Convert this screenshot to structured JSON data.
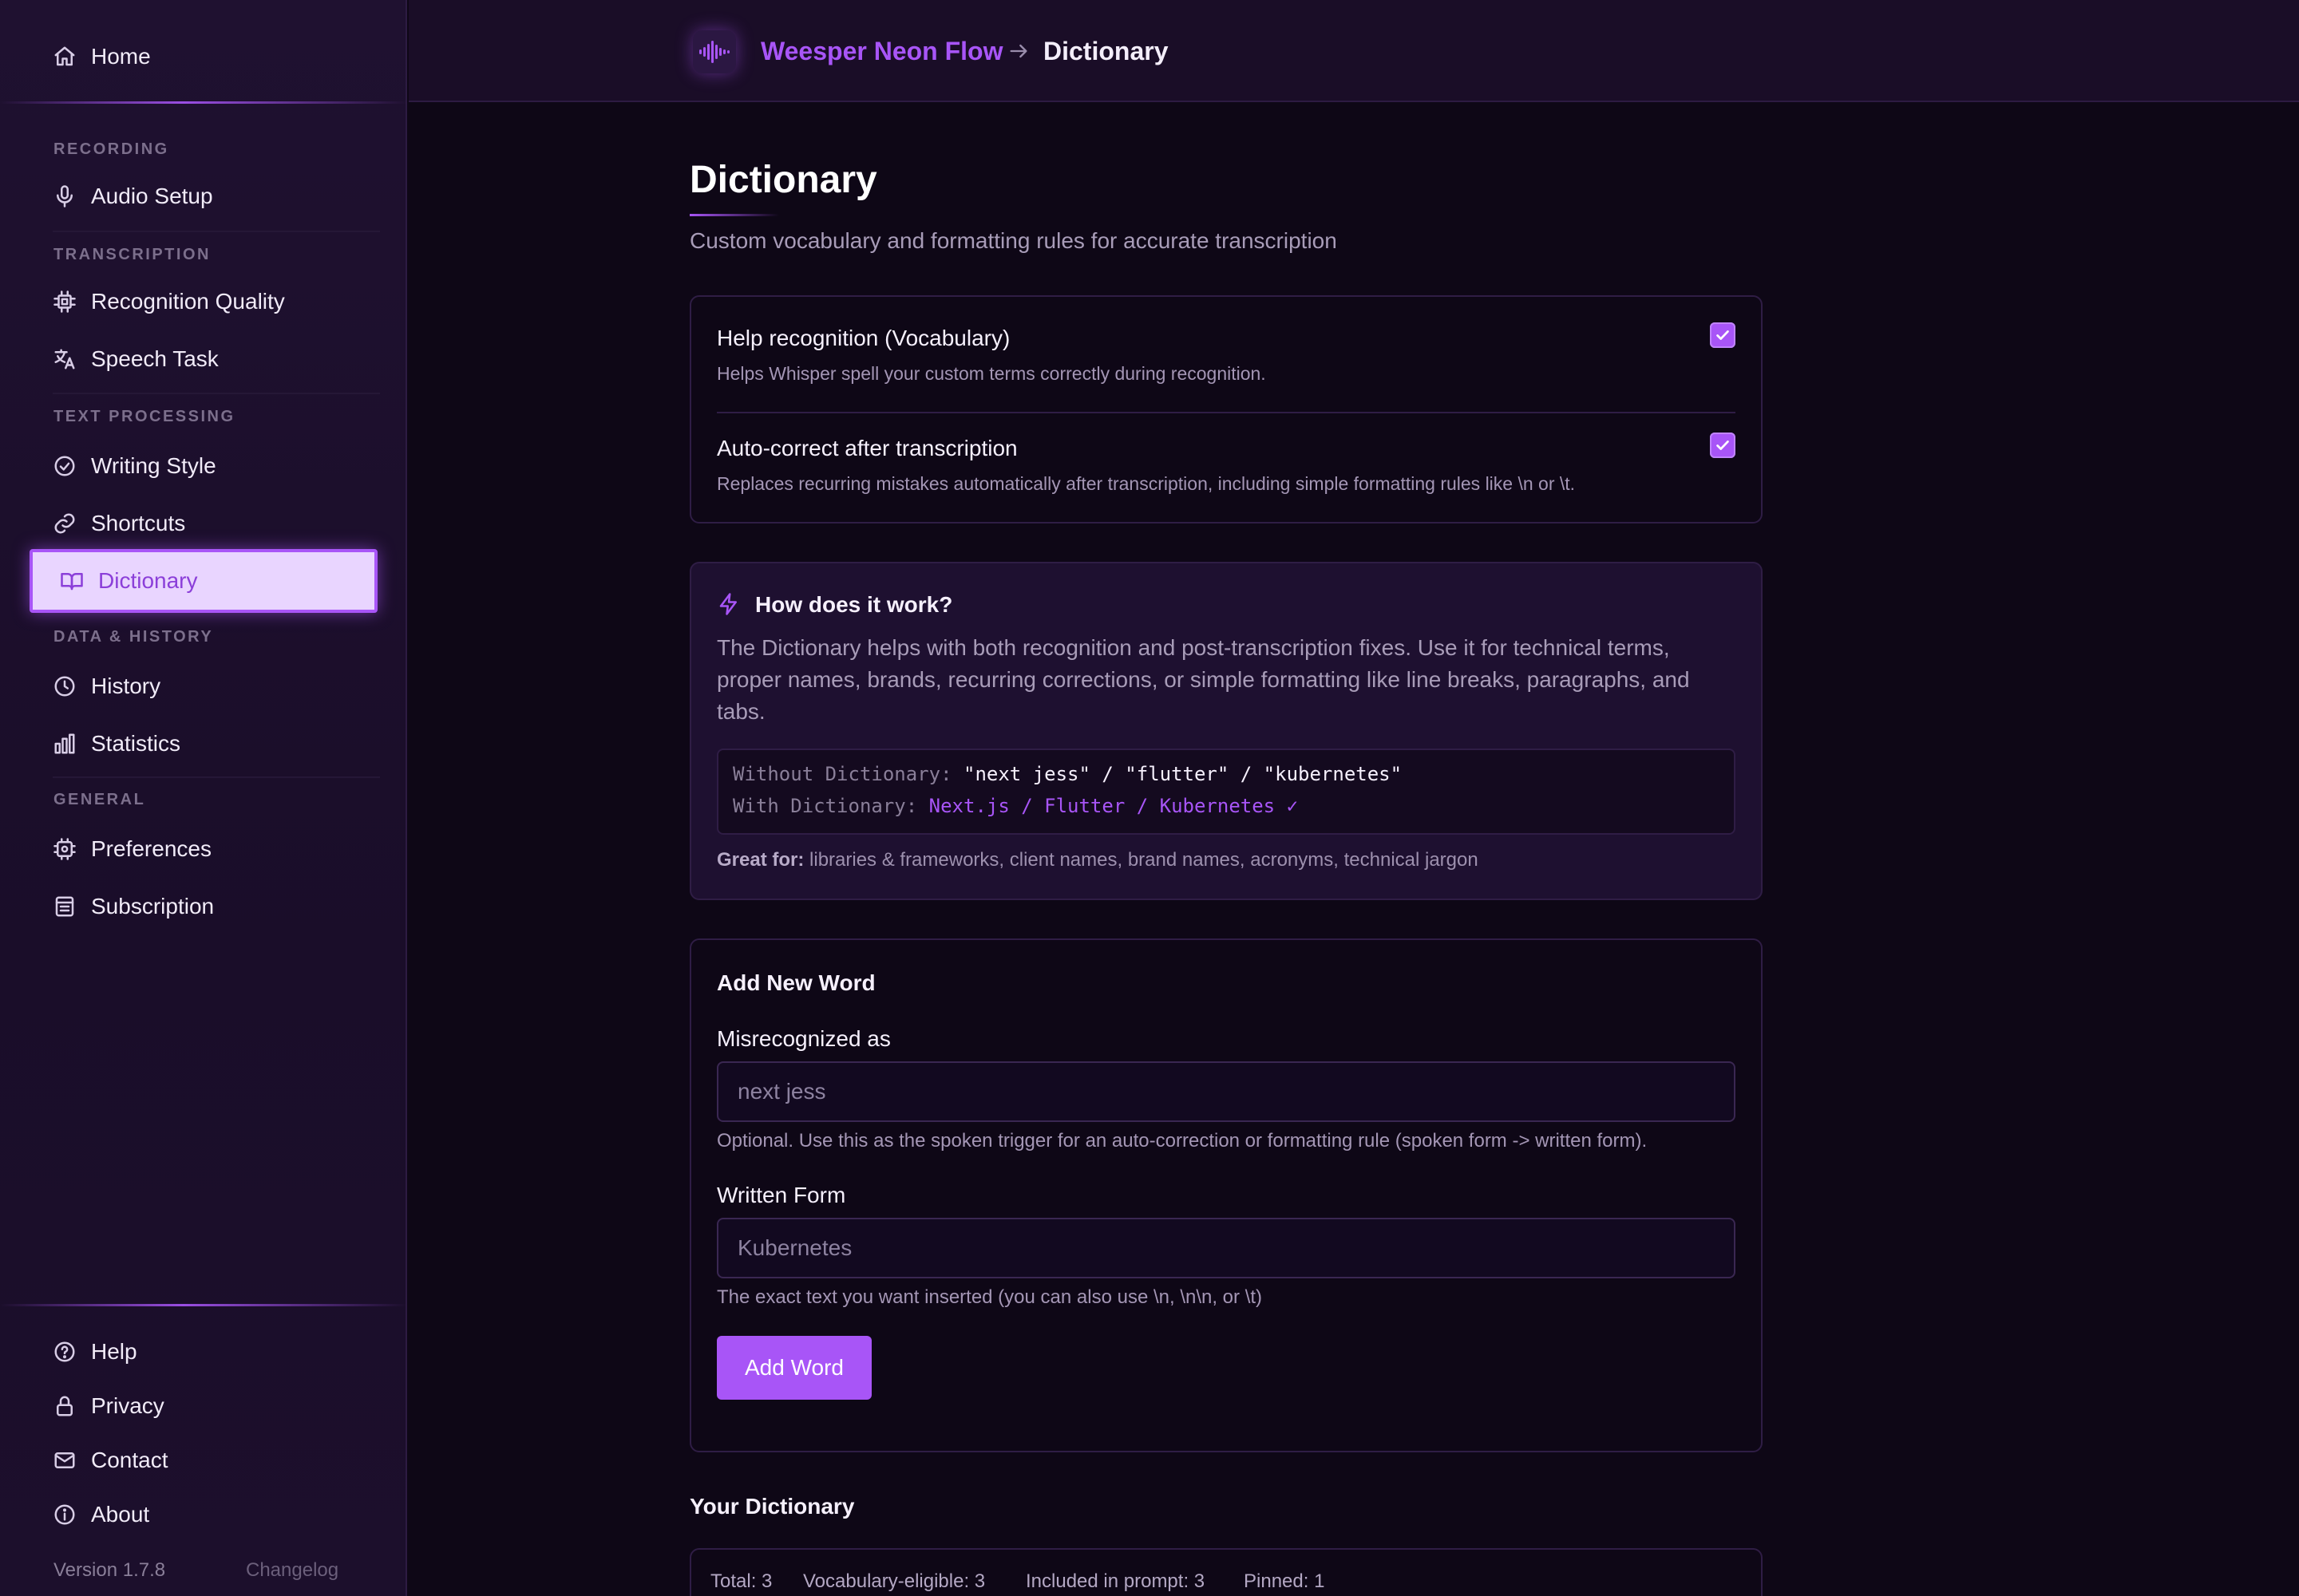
{
  "sidebar": {
    "home": "Home",
    "sections": {
      "recording": "RECORDING",
      "transcription": "TRANSCRIPTION",
      "text_processing": "TEXT PROCESSING",
      "data_history": "DATA & HISTORY",
      "general": "GENERAL"
    },
    "items": {
      "audio_setup": "Audio Setup",
      "recognition_quality": "Recognition Quality",
      "speech_task": "Speech Task",
      "writing_style": "Writing Style",
      "shortcuts": "Shortcuts",
      "dictionary": "Dictionary",
      "history": "History",
      "statistics": "Statistics",
      "preferences": "Preferences",
      "subscription": "Subscription"
    },
    "active_item": "dictionary",
    "footer": {
      "help": "Help",
      "privacy": "Privacy",
      "contact": "Contact",
      "about": "About",
      "version": "Version 1.7.8",
      "changelog": "Changelog"
    }
  },
  "breadcrumb": {
    "app_name": "Weesper Neon Flow",
    "current": "Dictionary"
  },
  "page": {
    "title": "Dictionary",
    "subtitle": "Custom vocabulary and formatting rules for accurate transcription"
  },
  "toggles": [
    {
      "title": "Help recognition (Vocabulary)",
      "description": "Helps Whisper spell your custom terms correctly during recognition.",
      "checked": true
    },
    {
      "title": "Auto-correct after transcription",
      "description": "Replaces recurring mistakes automatically after transcription, including simple formatting rules like \\n or \\t.",
      "checked": true
    }
  ],
  "info": {
    "heading": "How does it work?",
    "body": "The Dictionary helps with both recognition and post-transcription fixes. Use it for technical terms, proper names, brands, recurring corrections, or simple formatting like line breaks, paragraphs, and tabs.",
    "without_label": "Without Dictionary:",
    "without_value": "\"next jess\" / \"flutter\" / \"kubernetes\"",
    "with_label": "With Dictionary:",
    "with_value": "Next.js / Flutter / Kubernetes ✓",
    "great_for_label": "Great for:",
    "great_for_value": "libraries & frameworks, client names, brand names, acronyms, technical jargon"
  },
  "add_word": {
    "title": "Add New Word",
    "misrecognized_label": "Misrecognized as",
    "misrecognized_placeholder": "next jess",
    "misrecognized_value": "",
    "misrecognized_hint": "Optional. Use this as the spoken trigger for an auto-correction or formatting rule (spoken form -> written form).",
    "written_label": "Written Form",
    "written_placeholder": "Kubernetes",
    "written_value": "",
    "written_hint": "The exact text you want inserted (you can also use \\n, \\n\\n, or \\t)",
    "button": "Add Word"
  },
  "your_dictionary": {
    "title": "Your Dictionary",
    "stats": {
      "total": "Total: 3",
      "vocabulary_eligible": "Vocabulary-eligible: 3",
      "included_in_prompt": "Included in prompt: 3",
      "pinned": "Pinned: 1"
    }
  },
  "colors": {
    "accent": "#a855f7",
    "background": "#0e0716",
    "sidebar": "#1f1130",
    "active_nav_bg": "#e9d5ff"
  },
  "icons": {
    "home": "home-icon",
    "audio_setup": "microphone-icon",
    "recognition_quality": "chip-icon",
    "speech_task": "translate-icon",
    "writing_style": "check-circle-icon",
    "shortcuts": "link-icon",
    "dictionary": "book-open-icon",
    "history": "clock-icon",
    "statistics": "bar-chart-icon",
    "preferences": "cpu-settings-icon",
    "subscription": "receipt-icon",
    "help": "help-circle-icon",
    "privacy": "lock-icon",
    "contact": "mail-icon",
    "about": "info-icon",
    "info_heading": "lightning-icon",
    "logo": "waveform-icon"
  }
}
